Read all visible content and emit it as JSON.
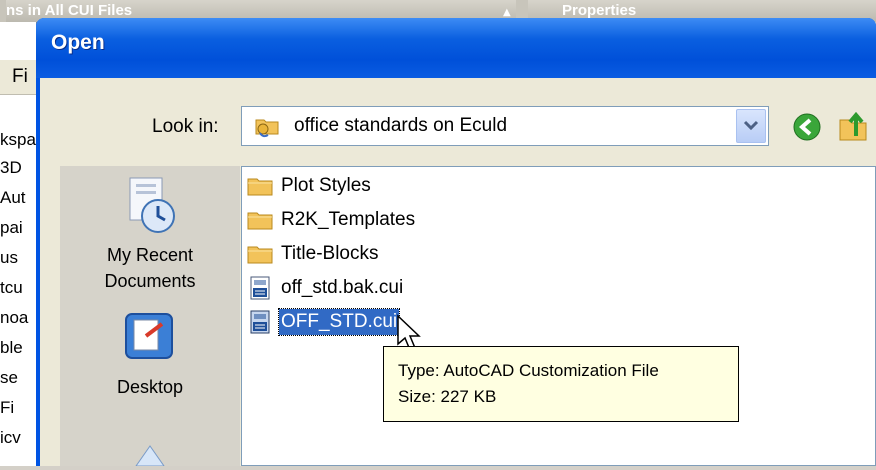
{
  "background_window": {
    "title_left": "ns in All CUI Files",
    "title_right": "Properties",
    "menu_fragment": "Fi",
    "tree_fragments": [
      "kspa",
      "3D",
      "Aut",
      "pai",
      "us",
      "tcu",
      "noa",
      "ble",
      "se",
      "Fi",
      "icv"
    ]
  },
  "dialog": {
    "title": "Open",
    "look_in_label": "Look in:",
    "look_in_value": "office standards on Eculd",
    "places": [
      {
        "label_line1": "My Recent",
        "label_line2": "Documents",
        "icon": "recent-documents-icon"
      },
      {
        "label_line1": "Desktop",
        "label_line2": "",
        "icon": "desktop-icon"
      },
      {
        "label_line1": "",
        "label_line2": "",
        "icon": "my-documents-icon"
      }
    ],
    "files": [
      {
        "name": "Plot Styles",
        "type": "folder",
        "selected": false
      },
      {
        "name": "R2K_Templates",
        "type": "folder",
        "selected": false
      },
      {
        "name": "Title-Blocks",
        "type": "folder",
        "selected": false
      },
      {
        "name": "off_std.bak.cui",
        "type": "cui-file",
        "selected": false
      },
      {
        "name": "OFF_STD.cui",
        "type": "cui-file",
        "selected": true
      }
    ],
    "tooltip": {
      "type_line": "Type: AutoCAD Customization File",
      "size_line": "Size: 227 KB"
    }
  },
  "colors": {
    "title_bar": "#0054e3",
    "selection": "#316ac5",
    "tooltip_bg": "#ffffe1",
    "folder": "#f2c35a"
  }
}
